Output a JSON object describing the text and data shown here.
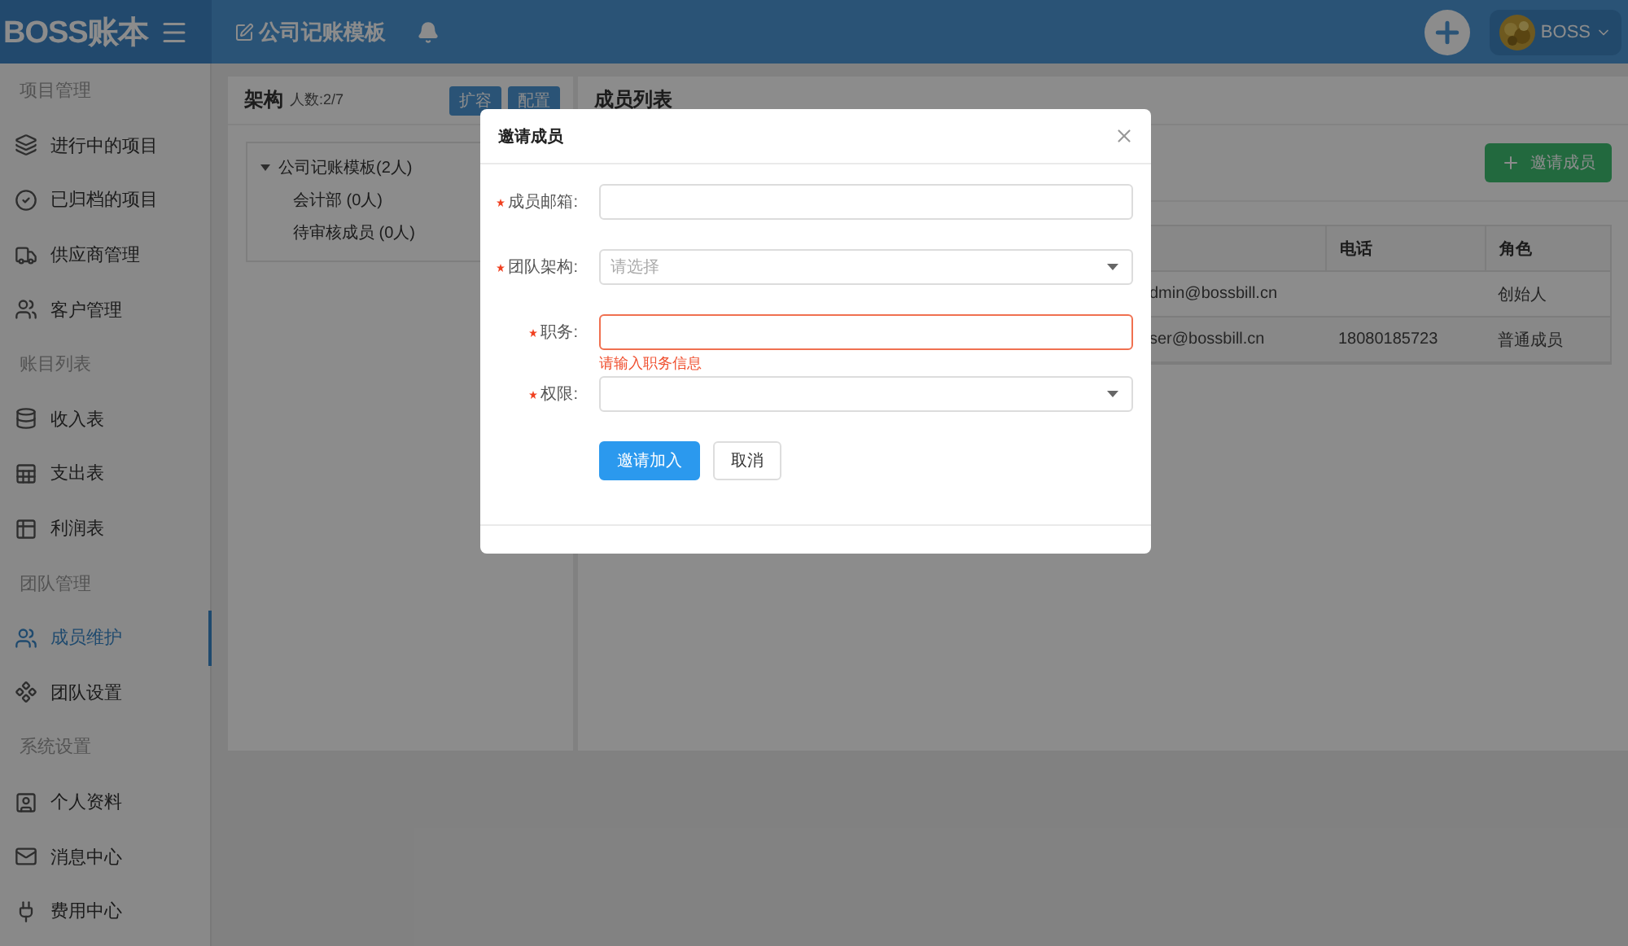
{
  "header": {
    "logo": "BOSS账本",
    "title": "公司记账模板",
    "user": "BOSS"
  },
  "sidebar": [
    {
      "kind": "group",
      "label": "项目管理"
    },
    {
      "kind": "item",
      "label": "进行中的项目",
      "selected": false
    },
    {
      "kind": "item",
      "label": "已归档的项目",
      "selected": false
    },
    {
      "kind": "item",
      "label": "供应商管理",
      "selected": false
    },
    {
      "kind": "item",
      "label": "客户管理",
      "selected": false
    },
    {
      "kind": "group",
      "label": "账目列表"
    },
    {
      "kind": "item",
      "label": "收入表",
      "selected": false
    },
    {
      "kind": "item",
      "label": "支出表",
      "selected": false
    },
    {
      "kind": "item",
      "label": "利润表",
      "selected": false
    },
    {
      "kind": "group",
      "label": "团队管理"
    },
    {
      "kind": "item",
      "label": "成员维护",
      "selected": true
    },
    {
      "kind": "item",
      "label": "团队设置",
      "selected": false
    },
    {
      "kind": "group",
      "label": "系统设置"
    },
    {
      "kind": "item",
      "label": "个人资料",
      "selected": false
    },
    {
      "kind": "item",
      "label": "消息中心",
      "selected": false
    },
    {
      "kind": "item",
      "label": "费用中心",
      "selected": false
    }
  ],
  "structure_panel": {
    "title": "架构",
    "count": "人数:2/7",
    "buttons": [
      "扩容",
      "配置"
    ],
    "tree": [
      {
        "label": "公司记账模板(2人)",
        "expanded": true,
        "children": [
          {
            "label": "会计部 (0人)"
          },
          {
            "label": "待审核成员 (0人)"
          }
        ]
      }
    ]
  },
  "member_panel": {
    "title": "成员列表",
    "invite_button": "邀请成员",
    "table": {
      "columns": [
        "电话",
        "角色"
      ],
      "rows": [
        {
          "email": "dmin@bossbill.cn",
          "role": "创始人"
        },
        {
          "email": "ser@bossbill.cn",
          "phone": "18080185723",
          "role": "普通成员"
        }
      ]
    }
  },
  "dialog": {
    "title": "邀请成员",
    "fields": [
      {
        "kind": "input",
        "label": "成员邮箱:",
        "required": true
      },
      {
        "kind": "select",
        "label": "团队架构:",
        "placeholder": "请选择",
        "required": true
      },
      {
        "kind": "input",
        "label": "职务:",
        "required": true,
        "error": "请输入职务信息"
      },
      {
        "kind": "select",
        "label": "权限:",
        "required": true
      }
    ],
    "buttons": [
      {
        "kind": "primary",
        "label": "邀请加入"
      },
      {
        "kind": "default",
        "label": "取消"
      }
    ]
  }
}
